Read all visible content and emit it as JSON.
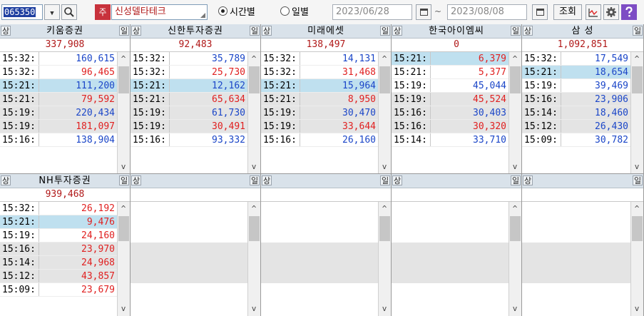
{
  "toolbar": {
    "code": "065350",
    "dropdown_glyph": "▼",
    "search_glyph": "⚲",
    "stock_tag": "주",
    "stock_name": "신성델타테크",
    "radio_time": "시간별",
    "radio_day": "일별",
    "date_from": "2023/06/28",
    "date_sep": "~",
    "date_to": "2023/08/08",
    "query": "조회"
  },
  "panels": [
    {
      "title": "키움증권",
      "total": "337,908",
      "rows": [
        [
          "15:32:",
          "160,615",
          "down"
        ],
        [
          "15:32:",
          "96,465",
          "up"
        ],
        [
          "15:21:",
          "111,200",
          "down"
        ],
        [
          "15:21:",
          "79,592",
          "up"
        ],
        [
          "15:19:",
          "220,434",
          "down"
        ],
        [
          "15:19:",
          "181,097",
          "up"
        ],
        [
          "15:16:",
          "138,904",
          "down"
        ]
      ]
    },
    {
      "title": "신한투자증권",
      "total": "92,483",
      "rows": [
        [
          "15:32:",
          "35,789",
          "down"
        ],
        [
          "15:32:",
          "25,730",
          "up"
        ],
        [
          "15:21:",
          "12,162",
          "down"
        ],
        [
          "15:21:",
          "65,634",
          "up"
        ],
        [
          "15:19:",
          "61,730",
          "down"
        ],
        [
          "15:19:",
          "30,491",
          "up"
        ],
        [
          "15:16:",
          "93,332",
          "down"
        ]
      ]
    },
    {
      "title": "미래에셋",
      "total": "138,497",
      "rows": [
        [
          "15:32:",
          "14,131",
          "down"
        ],
        [
          "15:32:",
          "31,468",
          "up"
        ],
        [
          "15:21:",
          "15,964",
          "down"
        ],
        [
          "15:21:",
          "8,950",
          "up"
        ],
        [
          "15:19:",
          "30,470",
          "down"
        ],
        [
          "15:19:",
          "33,644",
          "up"
        ],
        [
          "15:16:",
          "26,160",
          "down"
        ]
      ]
    },
    {
      "title": "한국아이엠씨",
      "total": "0",
      "rows": [
        [
          "15:21:",
          "6,379",
          "up"
        ],
        [
          "15:21:",
          "5,377",
          "up"
        ],
        [
          "15:19:",
          "45,044",
          "down"
        ],
        [
          "15:19:",
          "45,524",
          "up"
        ],
        [
          "15:16:",
          "30,403",
          "down"
        ],
        [
          "15:16:",
          "30,320",
          "up"
        ],
        [
          "15:14:",
          "33,710",
          "down"
        ]
      ]
    },
    {
      "title": "삼  성",
      "total": "1,092,851",
      "rows": [
        [
          "15:32:",
          "17,549",
          "down"
        ],
        [
          "15:21:",
          "18,654",
          "down"
        ],
        [
          "15:19:",
          "39,469",
          "down"
        ],
        [
          "15:16:",
          "23,906",
          "down"
        ],
        [
          "15:14:",
          "18,460",
          "down"
        ],
        [
          "15:12:",
          "26,430",
          "down"
        ],
        [
          "15:09:",
          "30,782",
          "down"
        ]
      ]
    },
    {
      "title": "NH투자증권",
      "total": "939,468",
      "rows": [
        [
          "15:32:",
          "26,192",
          "up"
        ],
        [
          "15:21:",
          "9,476",
          "up"
        ],
        [
          "15:19:",
          "24,160",
          "up"
        ],
        [
          "15:16:",
          "23,970",
          "up"
        ],
        [
          "15:14:",
          "24,968",
          "up"
        ],
        [
          "15:12:",
          "43,857",
          "up"
        ],
        [
          "15:09:",
          "23,679",
          "up"
        ]
      ]
    },
    {
      "title": "",
      "total": "",
      "rows": []
    },
    {
      "title": "",
      "total": "",
      "rows": []
    },
    {
      "title": "",
      "total": "",
      "rows": []
    },
    {
      "title": "",
      "total": "",
      "rows": []
    }
  ],
  "flags": {
    "left": "상",
    "right": "일"
  },
  "scroll": {
    "up": "^",
    "down": "v"
  }
}
